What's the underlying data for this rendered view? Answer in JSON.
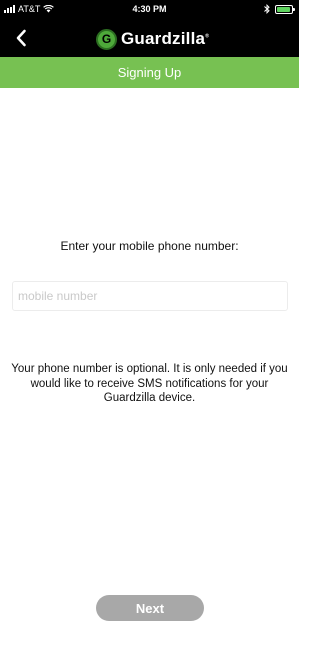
{
  "status_bar": {
    "carrier": "AT&T",
    "time": "4:30 PM",
    "battery_level": 0.9,
    "icons": [
      "signal-icon",
      "wifi-icon",
      "bluetooth-icon",
      "battery-icon"
    ]
  },
  "nav": {
    "back_icon": "chevron-left-icon",
    "brand": "Guardzilla",
    "brand_mark": "G",
    "brand_registered": "®"
  },
  "title_bar": {
    "title": "Signing Up"
  },
  "form": {
    "prompt": "Enter your mobile phone number:",
    "phone_placeholder": "mobile number",
    "phone_value": "",
    "info": "Your phone number is optional.  It is only needed if you would like to receive SMS notifications for your Guardzilla device."
  },
  "footer": {
    "next_label": "Next"
  },
  "colors": {
    "accent_green": "#77c152",
    "logo_green": "#4ea93a",
    "button_disabled": "#a8a8a8",
    "header_black": "#000000"
  }
}
